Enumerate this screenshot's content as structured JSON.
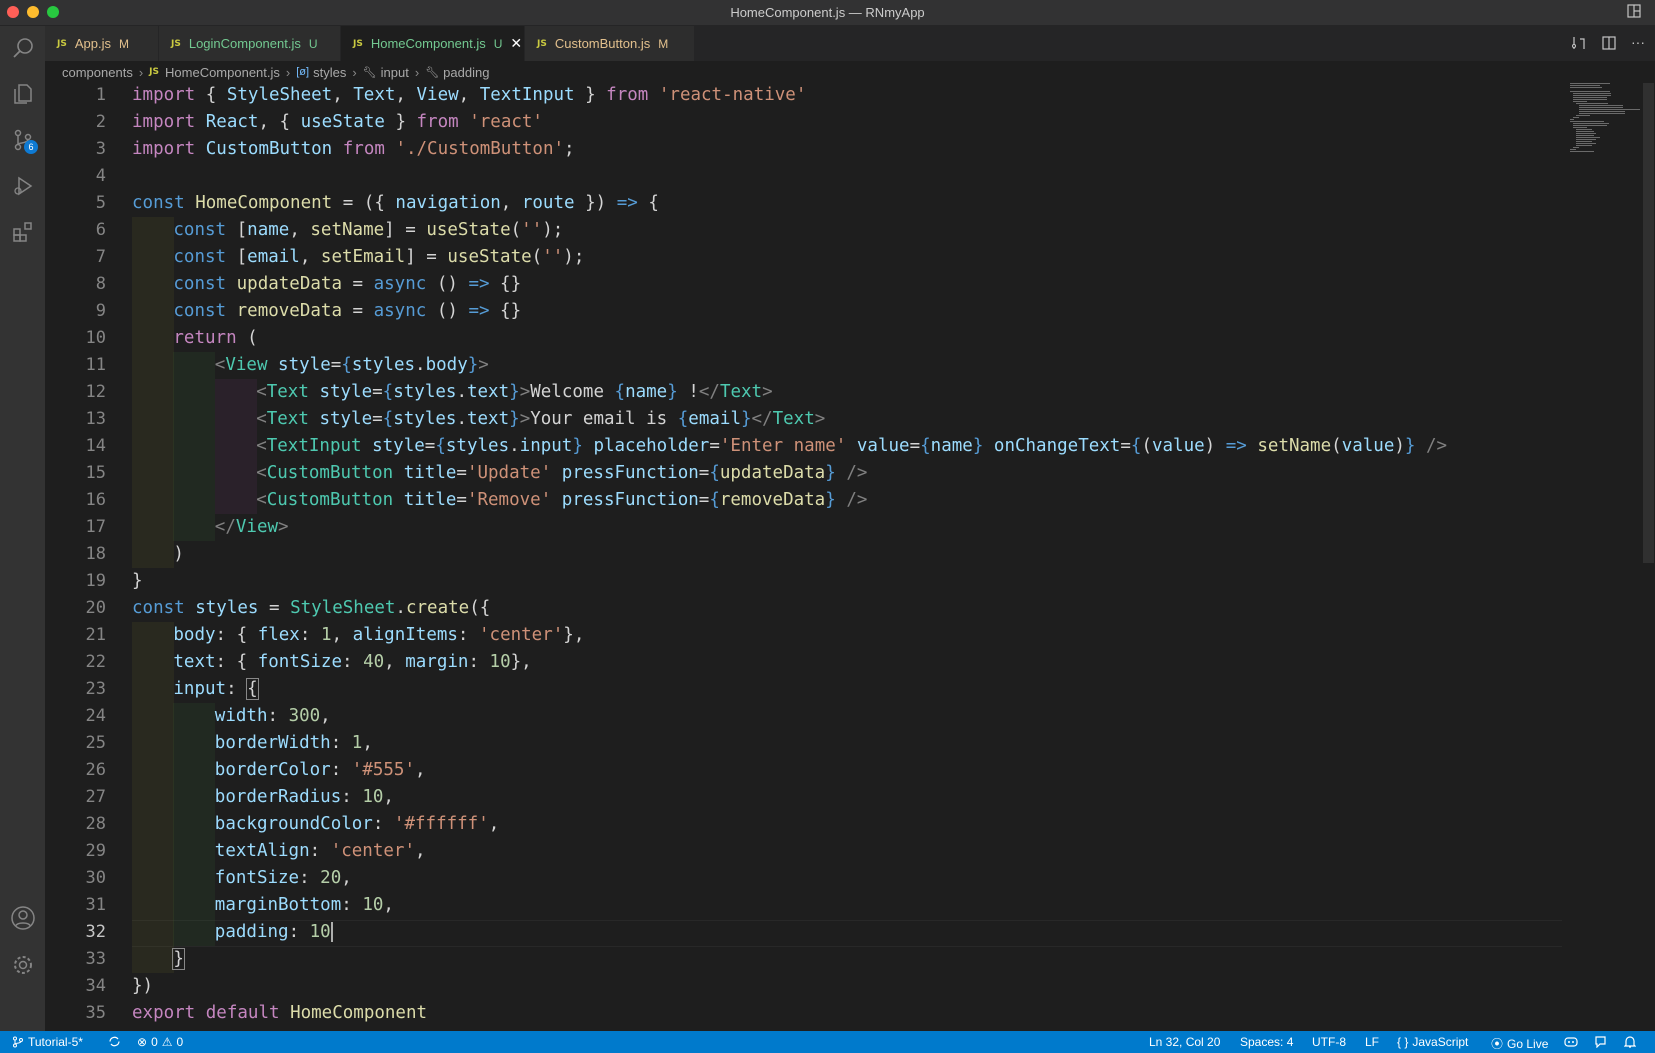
{
  "window": {
    "title": "HomeComponent.js — RNmyApp"
  },
  "activity_bar": {
    "source_control_badge": "6"
  },
  "tabs": [
    {
      "label": "App.js",
      "status": "M",
      "lang": "JS"
    },
    {
      "label": "LoginComponent.js",
      "status": "U",
      "lang": "JS"
    },
    {
      "label": "HomeComponent.js",
      "status": "U",
      "lang": "JS",
      "active": true
    },
    {
      "label": "CustomButton.js",
      "status": "M",
      "lang": "JS"
    }
  ],
  "breadcrumb": [
    "components",
    "HomeComponent.js",
    "styles",
    "input",
    "padding"
  ],
  "editor": {
    "current_line": 32,
    "line_numbers": [
      "1",
      "2",
      "3",
      "4",
      "5",
      "6",
      "7",
      "8",
      "9",
      "10",
      "11",
      "12",
      "13",
      "14",
      "15",
      "16",
      "17",
      "18",
      "19",
      "20",
      "21",
      "22",
      "23",
      "24",
      "25",
      "26",
      "27",
      "28",
      "29",
      "30",
      "31",
      "32",
      "33",
      "34",
      "35"
    ]
  },
  "code_tokens": {
    "l1": [
      "import",
      " { ",
      "StyleSheet",
      ", ",
      "Text",
      ", ",
      "View",
      ", ",
      "TextInput",
      " } ",
      "from",
      " ",
      "'react-native'"
    ],
    "l2": [
      "import",
      " ",
      "React",
      ", { ",
      "useState",
      " } ",
      "from",
      " ",
      "'react'"
    ],
    "l3": [
      "import",
      " ",
      "CustomButton",
      " ",
      "from",
      " ",
      "'./CustomButton'",
      ";"
    ],
    "l5": [
      "const",
      " ",
      "HomeComponent",
      " = ({ ",
      "navigation",
      ", ",
      "route",
      " }) ",
      "=>",
      " {"
    ],
    "l6": [
      "const",
      " [",
      "name",
      ", ",
      "setName",
      "] = ",
      "useState",
      "(",
      "''",
      ");"
    ],
    "l7": [
      "const",
      " [",
      "email",
      ", ",
      "setEmail",
      "] = ",
      "useState",
      "(",
      "''",
      ");"
    ],
    "l8": [
      "const",
      " ",
      "updateData",
      " = ",
      "async",
      " () ",
      "=>",
      " {}"
    ],
    "l9": [
      "const",
      " ",
      "removeData",
      " = ",
      "async",
      " () ",
      "=>",
      " {}"
    ],
    "l10": [
      "return",
      " ("
    ],
    "l11": [
      "<",
      "View",
      " ",
      "style",
      "=",
      "{",
      "styles",
      ".",
      "body",
      "}",
      ">"
    ],
    "l12": [
      "<",
      "Text",
      " ",
      "style",
      "=",
      "{",
      "styles",
      ".",
      "text",
      "}",
      ">",
      "Welcome ",
      "{",
      "name",
      "}",
      " !",
      "</",
      "Text",
      ">"
    ],
    "l13": [
      "<",
      "Text",
      " ",
      "style",
      "=",
      "{",
      "styles",
      ".",
      "text",
      "}",
      ">",
      "Your email is ",
      "{",
      "email",
      "}",
      "</",
      "Text",
      ">"
    ],
    "l14": [
      "<",
      "TextInput",
      " ",
      "style",
      "=",
      "{",
      "styles",
      ".",
      "input",
      "}",
      " ",
      "placeholder",
      "=",
      "'Enter name'",
      " ",
      "value",
      "=",
      "{",
      "name",
      "}",
      " ",
      "onChangeText",
      "=",
      "{",
      "(",
      "value",
      ") ",
      "=>",
      " ",
      "setName",
      "(",
      "value",
      ")",
      "}",
      " ",
      "/>"
    ],
    "l15": [
      "<",
      "CustomButton",
      " ",
      "title",
      "=",
      "'Update'",
      " ",
      "pressFunction",
      "=",
      "{",
      "updateData",
      "}",
      " ",
      "/>"
    ],
    "l16": [
      "<",
      "CustomButton",
      " ",
      "title",
      "=",
      "'Remove'",
      " ",
      "pressFunction",
      "=",
      "{",
      "removeData",
      "}",
      " ",
      "/>"
    ],
    "l17": [
      "</",
      "View",
      ">"
    ],
    "l18": [
      ")"
    ],
    "l19": [
      "}"
    ],
    "l20": [
      "const",
      " ",
      "styles",
      " = ",
      "StyleSheet",
      ".",
      "create",
      "({"
    ],
    "l21": [
      "body",
      ": { ",
      "flex",
      ": ",
      "1",
      ", ",
      "alignItems",
      ": ",
      "'center'",
      "},"
    ],
    "l22": [
      "text",
      ": { ",
      "fontSize",
      ": ",
      "40",
      ", ",
      "margin",
      ": ",
      "10",
      "},"
    ],
    "l23": [
      "input",
      ": ",
      "{"
    ],
    "l24": [
      "width",
      ": ",
      "300",
      ","
    ],
    "l25": [
      "borderWidth",
      ": ",
      "1",
      ","
    ],
    "l26": [
      "borderColor",
      ": ",
      "'#555'",
      ","
    ],
    "l27": [
      "borderRadius",
      ": ",
      "10",
      ","
    ],
    "l28": [
      "backgroundColor",
      ": ",
      "'#ffffff'",
      ","
    ],
    "l29": [
      "textAlign",
      ": ",
      "'center'",
      ","
    ],
    "l30": [
      "fontSize",
      ": ",
      "20",
      ","
    ],
    "l31": [
      "marginBottom",
      ": ",
      "10",
      ","
    ],
    "l32": [
      "padding",
      ": ",
      "10"
    ],
    "l33": [
      "}"
    ],
    "l34": [
      "})"
    ],
    "l35": [
      "export",
      " ",
      "default",
      " ",
      "HomeComponent"
    ]
  },
  "status_bar": {
    "branch": "Tutorial-5*",
    "errors": "0",
    "warnings": "0",
    "cursor": "Ln 32, Col 20",
    "spaces": "Spaces: 4",
    "encoding": "UTF-8",
    "eol": "LF",
    "language": "JavaScript",
    "golive": "Go Live"
  },
  "colors": {
    "statusbar": "#007acc",
    "editor_bg": "#1e1e1e",
    "keyword": "#569cd6",
    "control": "#c586c0",
    "function": "#dcdcaa",
    "variable": "#9cdcfe",
    "string": "#ce9178",
    "number": "#b5cea8",
    "component": "#4ec9b0"
  }
}
